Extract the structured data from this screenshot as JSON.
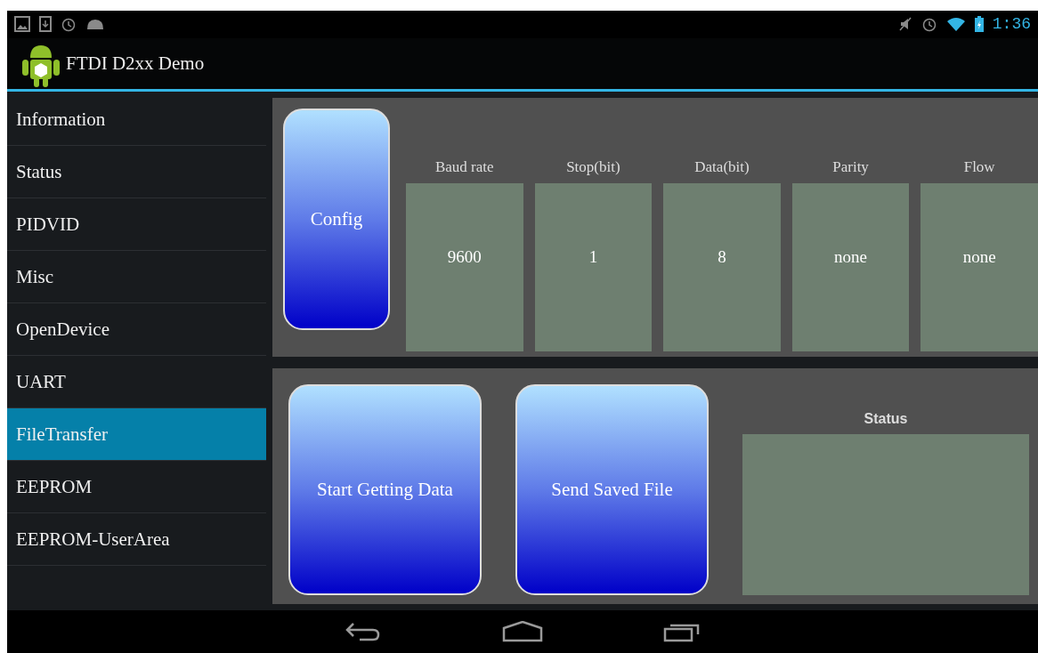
{
  "status_bar": {
    "time": "1:36"
  },
  "action_bar": {
    "title": "FTDI D2xx Demo"
  },
  "sidebar": {
    "items": [
      {
        "label": "Information",
        "selected": false
      },
      {
        "label": "Status",
        "selected": false
      },
      {
        "label": "PIDVID",
        "selected": false
      },
      {
        "label": "Misc",
        "selected": false
      },
      {
        "label": "OpenDevice",
        "selected": false
      },
      {
        "label": "UART",
        "selected": false
      },
      {
        "label": "FileTransfer",
        "selected": true
      },
      {
        "label": "EEPROM",
        "selected": false
      },
      {
        "label": "EEPROM-UserArea",
        "selected": false
      }
    ]
  },
  "config": {
    "button": "Config",
    "fields": [
      {
        "label": "Baud rate",
        "value": "9600"
      },
      {
        "label": "Stop(bit)",
        "value": "1"
      },
      {
        "label": "Data(bit)",
        "value": "8"
      },
      {
        "label": "Parity",
        "value": "none"
      },
      {
        "label": "Flow",
        "value": "none"
      }
    ]
  },
  "transfer": {
    "buttons": [
      "Start Getting Data",
      "Send Saved File"
    ],
    "status_label": "Status"
  }
}
